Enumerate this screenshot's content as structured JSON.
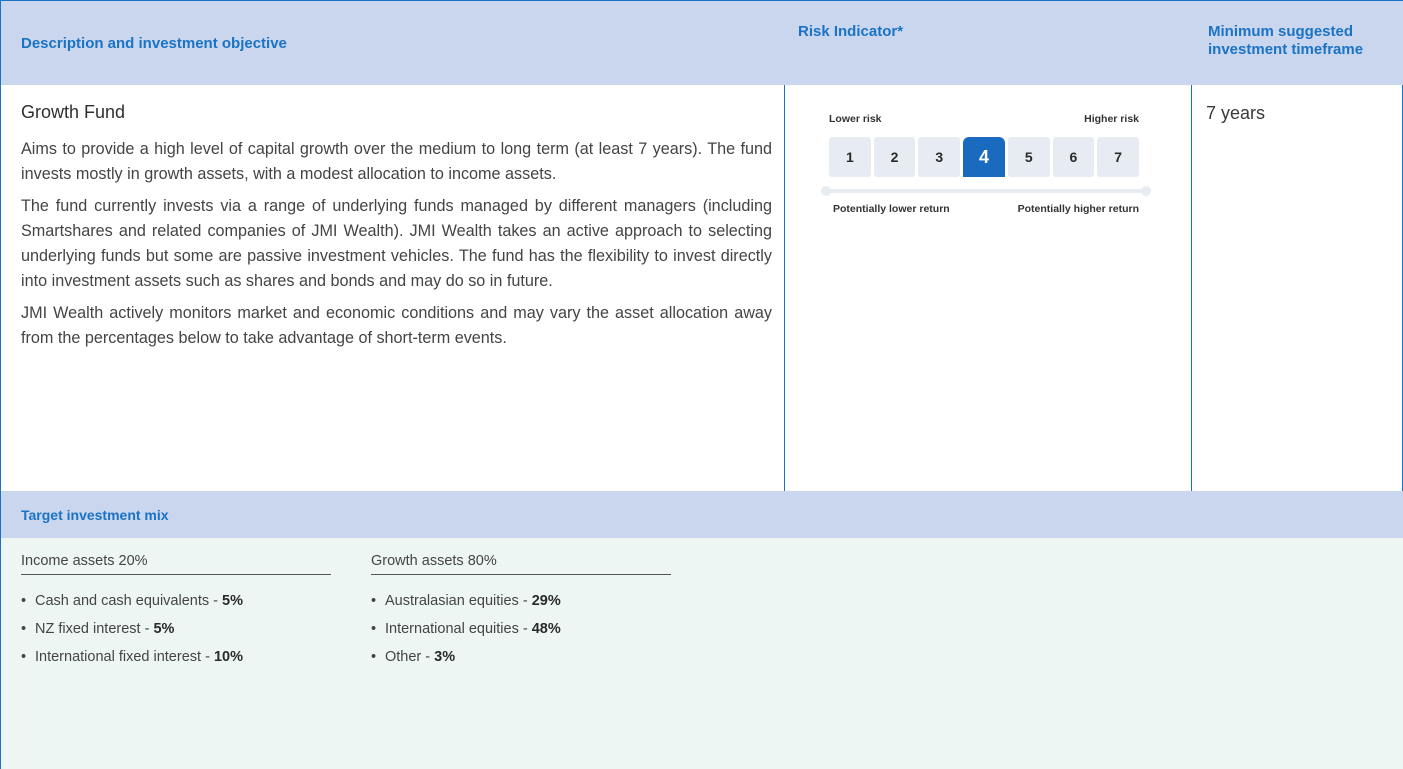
{
  "header": {
    "col1": "Description and investment objective",
    "col2": "Risk Indicator*",
    "col3": "Minimum suggested investment timeframe"
  },
  "fund": {
    "title": "Growth Fund",
    "paragraphs": [
      "Aims to provide a high level of capital growth over the medium to long term (at least 7 years). The fund invests mostly in growth assets, with a modest allocation to income assets.",
      "The fund currently invests via a range of underlying funds managed by different managers (including Smartshares and related companies of JMI Wealth). JMI Wealth takes an active approach to selecting underlying funds but some are passive investment vehicles. The fund has the flexibility to invest directly into investment assets such as shares and bonds and may do so in future.",
      "JMI Wealth actively monitors market and economic conditions and may vary the asset allocation away from the percentages below to take advantage of short-term events."
    ]
  },
  "risk": {
    "lower_label": "Lower risk",
    "higher_label": "Higher risk",
    "levels": [
      "1",
      "2",
      "3",
      "4",
      "5",
      "6",
      "7"
    ],
    "selected": 4,
    "lower_return": "Potentially lower return",
    "higher_return": "Potentially higher return",
    "active_color": "#1a6bbf"
  },
  "timeframe": "7 years",
  "mix": {
    "title": "Target investment mix",
    "income": {
      "title": "Income assets 20%",
      "items": [
        {
          "label": "Cash and cash equivalents - ",
          "value": "5%"
        },
        {
          "label": "NZ fixed interest - ",
          "value": "5%"
        },
        {
          "label": "International fixed interest - ",
          "value": "10%"
        }
      ]
    },
    "growth": {
      "title": "Growth assets 80%",
      "items": [
        {
          "label": "Australasian equities - ",
          "value": "29%"
        },
        {
          "label": "International equities - ",
          "value": "48%"
        },
        {
          "label": "Other - ",
          "value": "3%"
        }
      ]
    }
  }
}
